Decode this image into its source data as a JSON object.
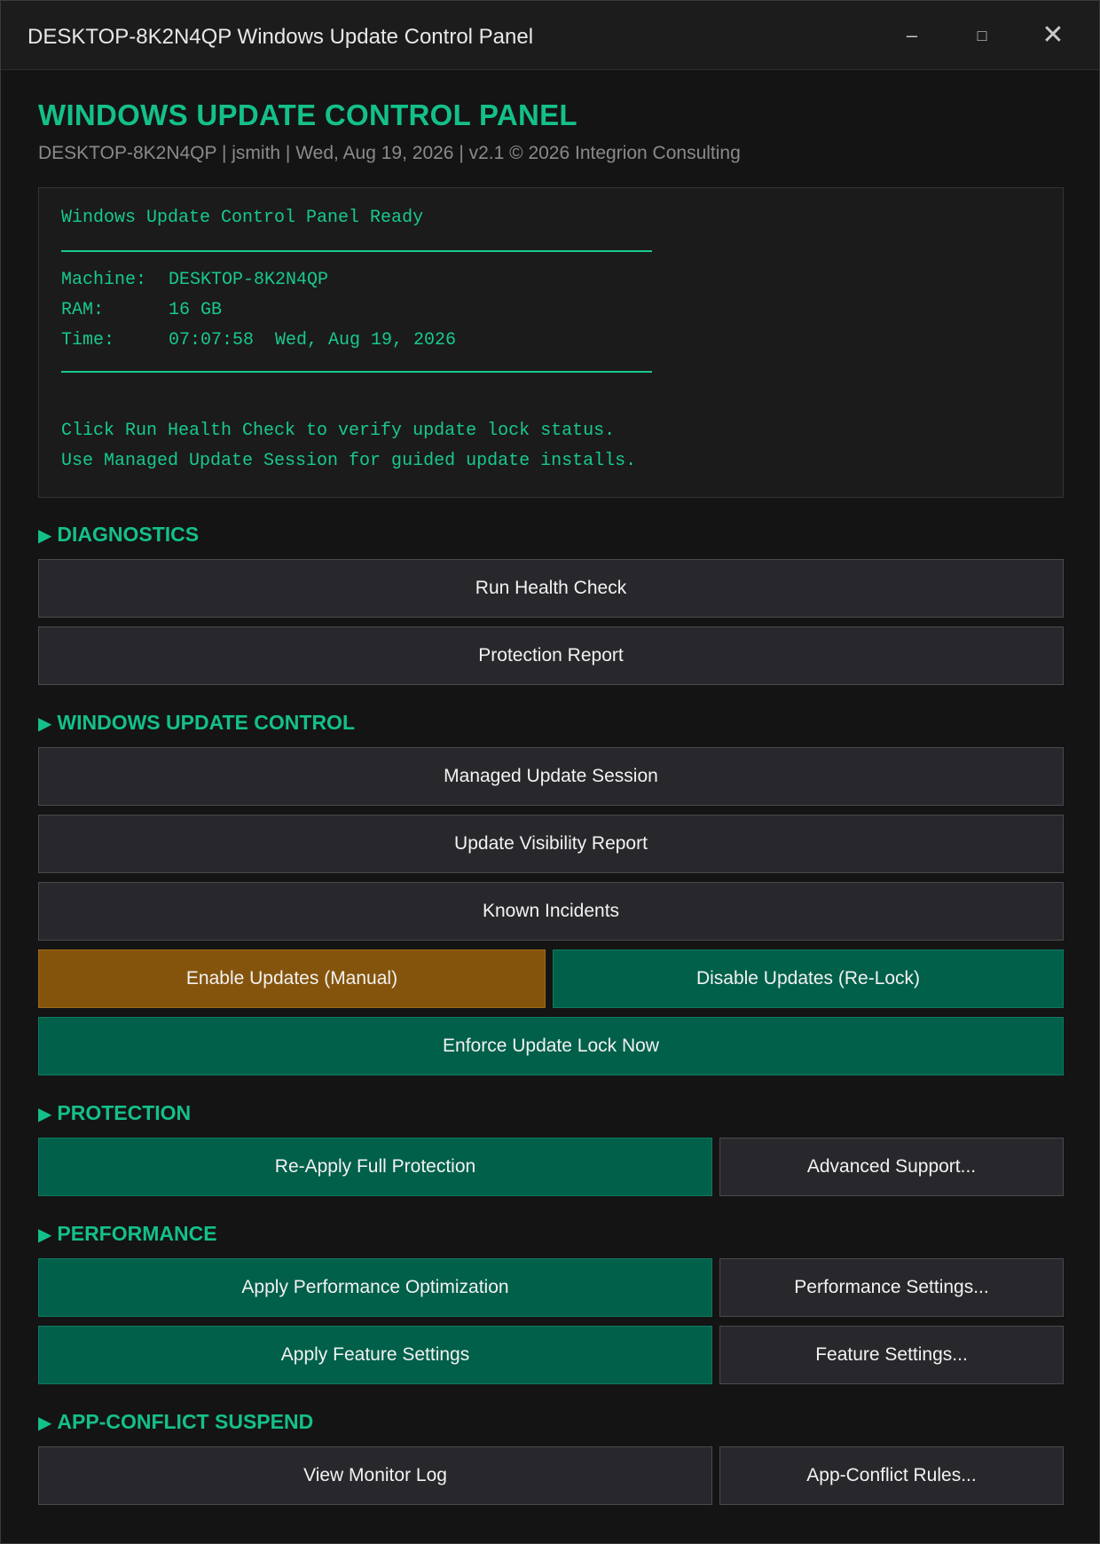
{
  "window": {
    "title": "DESKTOP-8K2N4QP Windows Update Control Panel",
    "minimize_glyph": "–",
    "maximize_glyph": "□",
    "close_glyph": "✕"
  },
  "header": {
    "title": "WINDOWS UPDATE CONTROL PANEL",
    "subtitle": "DESKTOP-8K2N4QP | jsmith | Wed, Aug 19, 2026 | v2.1 © 2026 Integrion Consulting"
  },
  "console": {
    "status": "Windows Update Control Panel Ready",
    "machine_label": "Machine:",
    "machine_value": "DESKTOP-8K2N4QP",
    "ram_label": "RAM:",
    "ram_value": "16 GB",
    "time_label": "Time:",
    "time_value": "07:07:58  Wed, Aug 19, 2026",
    "hint1": "Click Run Health Check to verify update lock status.",
    "hint2": "Use Managed Update Session for guided update installs."
  },
  "sections": {
    "diagnostics": {
      "title": "DIAGNOSTICS",
      "run_health_check": "Run Health Check",
      "protection_report": "Protection Report"
    },
    "update_control": {
      "title": "WINDOWS UPDATE CONTROL",
      "managed_session": "Managed Update Session",
      "visibility_report": "Update Visibility Report",
      "known_incidents": "Known Incidents",
      "enable_updates": "Enable Updates (Manual)",
      "disable_updates": "Disable Updates (Re-Lock)",
      "enforce_lock": "Enforce Update Lock Now"
    },
    "protection": {
      "title": "PROTECTION",
      "reapply": "Re-Apply Full Protection",
      "advanced_support": "Advanced Support..."
    },
    "performance": {
      "title": "PERFORMANCE",
      "apply_optimization": "Apply Performance Optimization",
      "performance_settings": "Performance Settings...",
      "apply_feature": "Apply Feature Settings",
      "feature_settings": "Feature Settings..."
    },
    "app_conflict": {
      "title": "APP-CONFLICT SUSPEND",
      "view_log": "View Monitor Log",
      "rules": "App-Conflict Rules..."
    }
  },
  "section_marker": "▶",
  "colors": {
    "accent": "#14c08a",
    "green_button": "#00604a",
    "amber_button": "#85540c",
    "neutral_button": "#28282c"
  }
}
